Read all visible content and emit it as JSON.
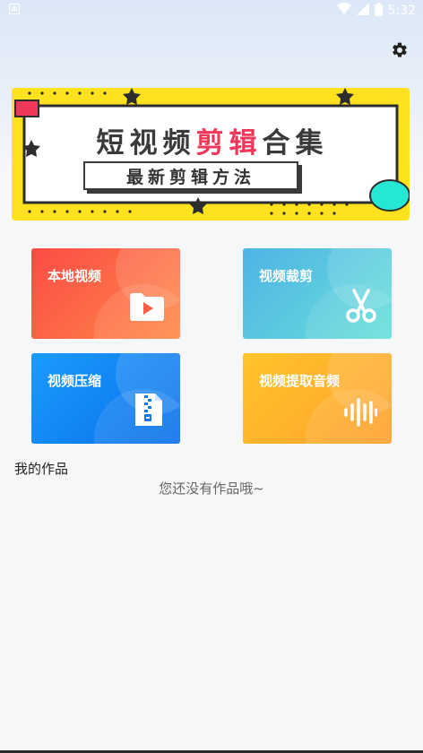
{
  "status_bar": {
    "time": "5:32",
    "left_icon": "android-notification-icon",
    "icons": [
      "wifi-icon",
      "signal-icon",
      "battery-icon"
    ]
  },
  "header": {
    "settings_icon": "gear-icon"
  },
  "banner": {
    "title_part1": "短视频",
    "title_highlight": "剪辑",
    "title_part2": "合集",
    "subtitle": "最新剪辑方法",
    "colors": {
      "background": "#ffe21f",
      "highlight": "#f2385a",
      "accent_red": "#f2385a",
      "accent_teal": "#24e8d4"
    }
  },
  "tools": [
    {
      "label": "本地视频",
      "icon": "folder-play-icon"
    },
    {
      "label": "视频裁剪",
      "icon": "scissors-icon"
    },
    {
      "label": "视频压缩",
      "icon": "zip-file-icon"
    },
    {
      "label": "视频提取音频",
      "icon": "audio-wave-icon"
    }
  ],
  "works": {
    "title": "我的作品",
    "empty_text": "您还没有作品哦~"
  }
}
